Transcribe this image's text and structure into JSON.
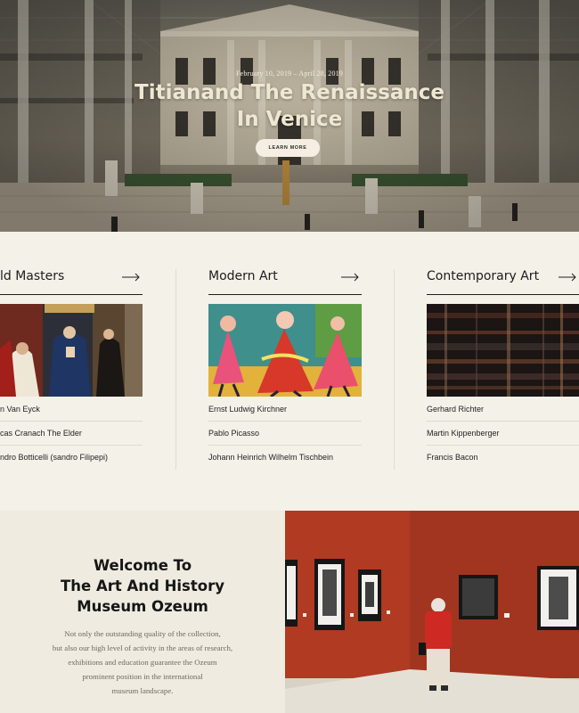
{
  "hero": {
    "dates": "February 10, 2019 – April 28, 2019",
    "title_line1": "Titianand The Renaissance",
    "title_line2": "In Venice",
    "button_label": "LEARN MORE"
  },
  "collections": [
    {
      "title": "ld Masters",
      "icon": "arrow-right-icon",
      "artists": [
        "n Van Eyck",
        "cas Cranach The Elder",
        "ndro Botticelli (sandro Filipepi)"
      ]
    },
    {
      "title": "Modern Art",
      "icon": "arrow-right-icon",
      "artists": [
        "Ernst Ludwig Kirchner",
        "Pablo Picasso",
        "Johann Heinrich Wilhelm Tischbein"
      ]
    },
    {
      "title": "Contemporary Art",
      "icon": "arrow-right-icon",
      "artists": [
        "Gerhard Richter",
        "Martin Kippenberger",
        "Francis Bacon"
      ]
    }
  ],
  "welcome": {
    "title_lines": [
      "Welcome To",
      "The Art And History",
      "Museum Ozeum"
    ],
    "text_lines": [
      "Not only the outstanding quality of the collection,",
      "but also our high level of activity in the areas of research,",
      "exhibitions and education guarantee the Ozeum",
      "prominent position in the international",
      "museum landscape."
    ]
  },
  "colors": {
    "background": "#f4f1e9",
    "welcome_background": "#efebe0",
    "gallery_wall": "#b03a22",
    "title_text": "#efe7d2"
  }
}
